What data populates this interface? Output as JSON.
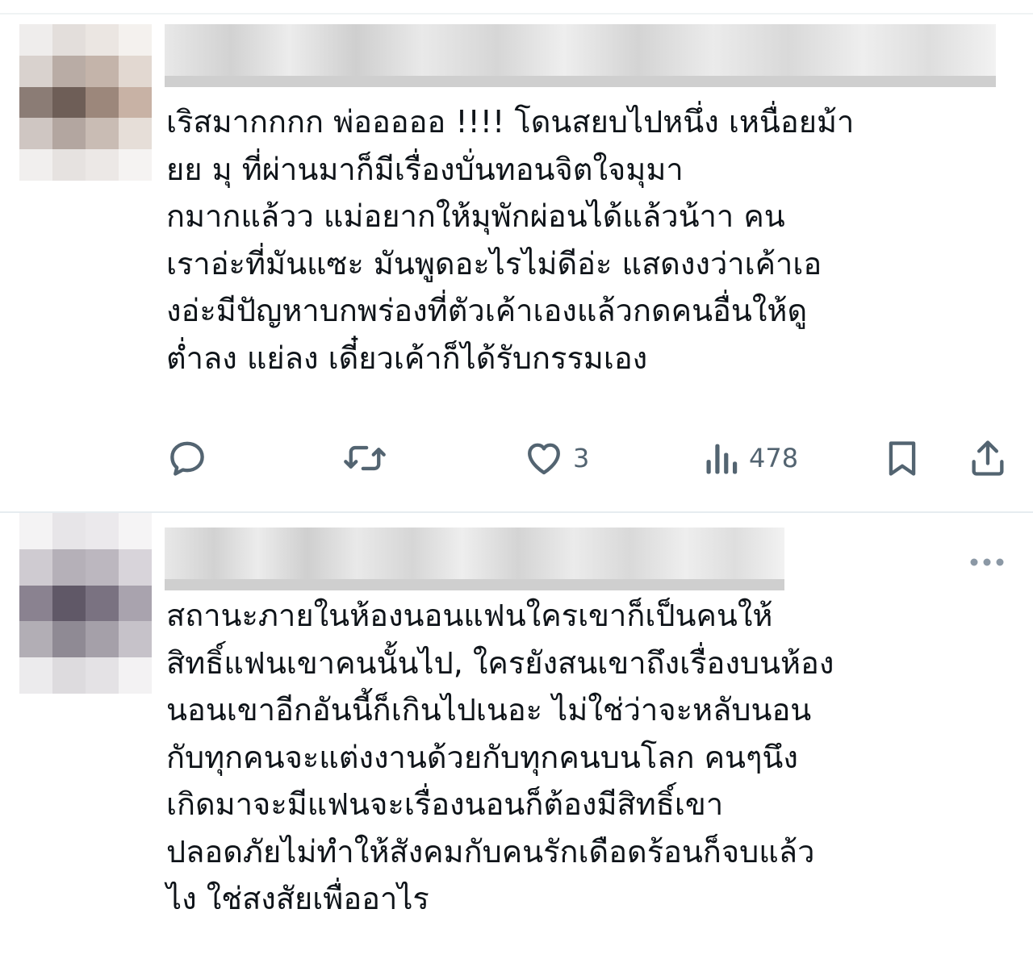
{
  "posts": [
    {
      "text": "เริสมากกกก พ่อออออ !!!! โดนสยบไปหนึ่ง  เหนื่อยม้า\nยย มุ ที่ผ่านมาก็มีเรื่องบั่นทอนจิตใจมุมา\nกมากแล้วว แม่อยากให้มุพักผ่อนได้แล้วน้าา  คน\nเราอ่ะที่มันแซะ มันพูดอะไรไม่ดีอ่ะ แสดงงว่าเค้าเอ\nงอ่ะมีปัญหาบกพร่องที่ตัวเค้าเองแล้วกดคนอื่นให้ดู\nต่ำลง แย่ลง  เดี๋ยวเค้าก็ได้รับกรรมเอง",
      "actions": {
        "reply_icon": "reply-icon",
        "repost_icon": "repost-icon",
        "like_icon": "heart-icon",
        "like_count": "3",
        "views_icon": "views-bar-chart-icon",
        "views_count": "478",
        "bookmark_icon": "bookmark-icon",
        "share_icon": "share-icon"
      }
    },
    {
      "more_icon": "more-horizontal-icon",
      "text": "สถานะภายในห้องนอนแฟนใครเขาก็เป็นคนให้\nสิทธิ์แฟนเขาคนนั้นไป, ใครยังสนเขาถึงเรื่องบนห้อง\nนอนเขาอีกอันนี้ก็เกินไปเนอะ ไม่ใช่ว่าจะหลับนอน\nกับทุกคนจะแต่งงานด้วยกับทุกคนบนโลก คนๆนึง\nเกิดมาจะมีแฟนจะเรื่องนอนก็ต้องมีสิทธิ์เขา\nปลอดภัยไม่ทำให้สังคมกับคนรักเดือดร้อนก็จบแล้ว\nไง ใช่สงสัยเพื่ออาไร"
    }
  ],
  "colors": {
    "text": "#0f1419",
    "icon": "#536471",
    "divider": "#e6ecf0"
  }
}
